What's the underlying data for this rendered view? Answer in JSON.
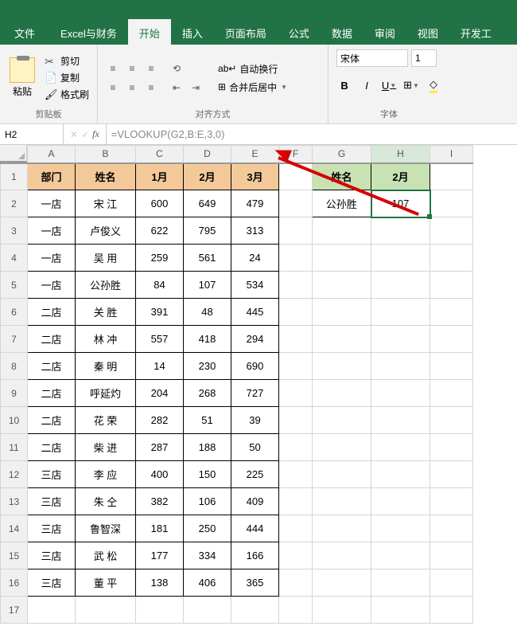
{
  "tabs": {
    "file": "文件",
    "excel_fin": "Excel与财务",
    "start": "开始",
    "insert": "插入",
    "layout": "页面布局",
    "formula": "公式",
    "data": "数据",
    "review": "审阅",
    "view": "视图",
    "dev": "开发工"
  },
  "ribbon": {
    "clipboard": {
      "paste": "粘贴",
      "cut": "剪切",
      "copy": "复制",
      "brush": "格式刷",
      "label": "剪贴板"
    },
    "align": {
      "wrap": "自动换行",
      "merge": "合并后居中",
      "label": "对齐方式"
    },
    "font": {
      "name": "宋体",
      "size": "1",
      "b": "B",
      "i": "I",
      "u": "U",
      "label": "字体"
    }
  },
  "fbar": {
    "name": "H2",
    "formula": "=VLOOKUP(G2,B:E,3,0)"
  },
  "cols": [
    "A",
    "B",
    "C",
    "D",
    "E",
    "F",
    "G",
    "H",
    "I"
  ],
  "rows": [
    "1",
    "2",
    "3",
    "4",
    "5",
    "6",
    "7",
    "8",
    "9",
    "10",
    "11",
    "12",
    "13",
    "14",
    "15",
    "16",
    "17"
  ],
  "main_headers": [
    "部门",
    "姓名",
    "1月",
    "2月",
    "3月"
  ],
  "lookup_headers": [
    "姓名",
    "2月"
  ],
  "lookup_row": [
    "公孙胜",
    "107"
  ],
  "table": [
    [
      "一店",
      "宋  江",
      "600",
      "649",
      "479"
    ],
    [
      "一店",
      "卢俊义",
      "622",
      "795",
      "313"
    ],
    [
      "一店",
      "吴  用",
      "259",
      "561",
      "24"
    ],
    [
      "一店",
      "公孙胜",
      "84",
      "107",
      "534"
    ],
    [
      "二店",
      "关  胜",
      "391",
      "48",
      "445"
    ],
    [
      "二店",
      "林  冲",
      "557",
      "418",
      "294"
    ],
    [
      "二店",
      "秦  明",
      "14",
      "230",
      "690"
    ],
    [
      "二店",
      "呼延灼",
      "204",
      "268",
      "727"
    ],
    [
      "二店",
      "花  荣",
      "282",
      "51",
      "39"
    ],
    [
      "二店",
      "柴  进",
      "287",
      "188",
      "50"
    ],
    [
      "三店",
      "李  应",
      "400",
      "150",
      "225"
    ],
    [
      "三店",
      "朱  仝",
      "382",
      "106",
      "409"
    ],
    [
      "三店",
      "鲁智深",
      "181",
      "250",
      "444"
    ],
    [
      "三店",
      "武  松",
      "177",
      "334",
      "166"
    ],
    [
      "三店",
      "董  平",
      "138",
      "406",
      "365"
    ]
  ]
}
